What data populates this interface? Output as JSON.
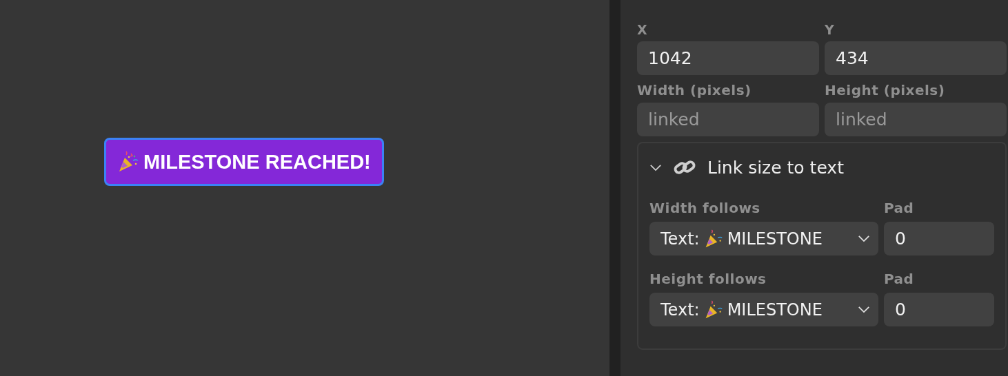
{
  "canvas": {
    "badge": {
      "text": "MILESTONE REACHED!",
      "selected": true
    }
  },
  "panel": {
    "fields": [
      {
        "label": "X",
        "value": "1042"
      },
      {
        "label": "Y",
        "value": "434"
      },
      {
        "label": "Width (pixels)",
        "placeholder": "linked"
      },
      {
        "label": "Height (pixels)",
        "placeholder": "linked"
      }
    ],
    "link_section": {
      "title": "Link size to text",
      "expanded": true,
      "rows": [
        {
          "label": "Width follows",
          "select_prefix": "Text:",
          "select_value": "MILESTONE",
          "pad_label": "Pad",
          "pad_value": "0"
        },
        {
          "label": "Height follows",
          "select_prefix": "Text:",
          "select_value": "MILESTONE",
          "pad_label": "Pad",
          "pad_value": "0"
        }
      ]
    }
  }
}
